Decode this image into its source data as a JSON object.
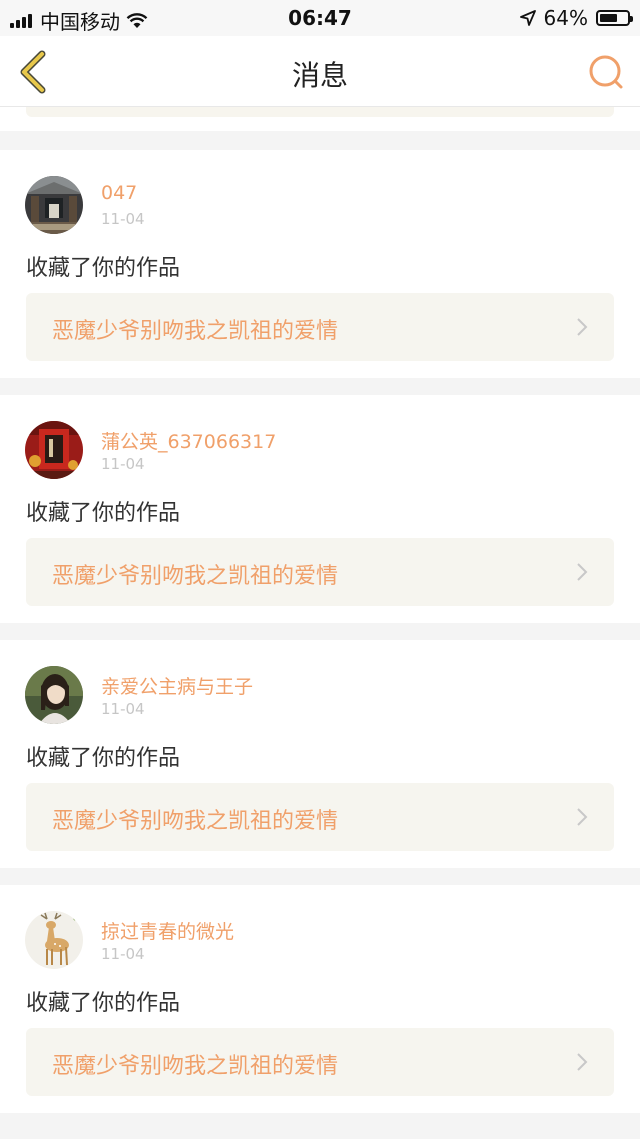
{
  "status_bar": {
    "carrier": "中国移动",
    "time": "06:47",
    "battery_percent": "64%",
    "battery_level": 0.64,
    "icons": [
      "signal-icon",
      "wifi-icon",
      "location-arrow-icon",
      "battery-icon"
    ]
  },
  "nav": {
    "title": "消息",
    "back_icon": "back-chevron-icon",
    "search_icon": "search-icon"
  },
  "colors": {
    "accent": "#f0a06a",
    "back_icon": "#e8c84a",
    "card_box": "#f6f5ef",
    "page_bg": "#f4f4f4"
  },
  "messages": [
    {
      "username": "047",
      "date": "11-04",
      "action": "收藏了你的作品",
      "work_title": "恶魔少爷别吻我之凯祖的爱情",
      "avatar": "library-photo"
    },
    {
      "username": "蒲公英_637066317",
      "date": "11-04",
      "action": "收藏了你的作品",
      "work_title": "恶魔少爷别吻我之凯祖的爱情",
      "avatar": "red-lantern-photo"
    },
    {
      "username": "亲爱公主病与王子",
      "date": "11-04",
      "action": "收藏了你的作品",
      "work_title": "恶魔少爷别吻我之凯祖的爱情",
      "avatar": "girl-portrait-photo"
    },
    {
      "username": "掠过青春的微光",
      "date": "11-04",
      "action": "收藏了你的作品",
      "work_title": "恶魔少爷别吻我之凯祖的爱情",
      "avatar": "deer-illustration"
    }
  ]
}
